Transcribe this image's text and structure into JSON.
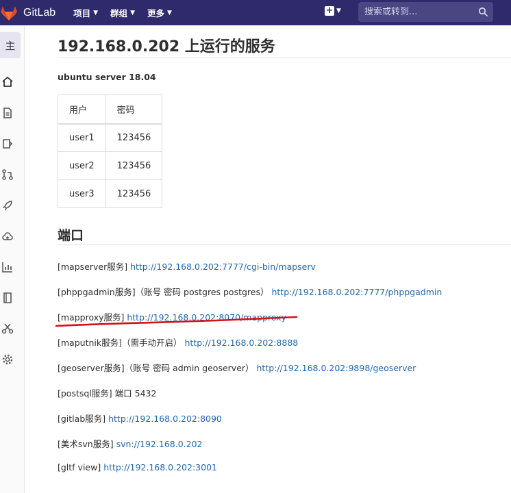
{
  "navbar": {
    "brand": "GitLab",
    "menu": [
      {
        "label": "项目"
      },
      {
        "label": "群组"
      },
      {
        "label": "更多"
      }
    ],
    "search_placeholder": "搜索或转到...",
    "colors": {
      "background": "#2f2a6b",
      "search_bg": "#4a4583"
    }
  },
  "sidebar": {
    "avatar_letter": "主",
    "icons": [
      "home-icon",
      "document-icon",
      "issues-icon",
      "merge-request-icon",
      "rocket-icon",
      "cloud-icon",
      "analytics-icon",
      "wiki-icon",
      "snippets-icon",
      "settings-icon"
    ]
  },
  "page": {
    "title": "192.168.0.202 上运行的服务",
    "subtitle": "ubuntu server 18.04",
    "table": {
      "headers": [
        "用户",
        "密码"
      ],
      "rows": [
        [
          "user1",
          "123456"
        ],
        [
          "user2",
          "123456"
        ],
        [
          "user3",
          "123456"
        ]
      ]
    },
    "ports_title": "端口",
    "services": [
      {
        "text": "[mapserver服务] ",
        "link": "http://192.168.0.202:7777/cgi-bin/mapserv"
      },
      {
        "text": "[phppgadmin服务]（账号 密码 postgres postgres） ",
        "link": "http://192.168.0.202:7777/phppgadmin"
      },
      {
        "text": "[mapproxy服务] ",
        "link": "http://192.168.0.202:8070/mapproxy"
      },
      {
        "text": "[maputnik服务]（需手动开启） ",
        "link": "http://192.168.0.202:8888"
      },
      {
        "text": "[geoserver服务]（账号 密码 admin geoserver） ",
        "link": "http://192.168.0.202:9898/geoserver"
      },
      {
        "text": "[postsql服务] 端口 5432",
        "link": ""
      },
      {
        "text": "[gitlab服务] ",
        "link": "http://192.168.0.202:8090"
      },
      {
        "text": "[美术svn服务] ",
        "link": "svn://192.168.0.202"
      },
      {
        "text": "[gltf view] ",
        "link": "http://192.168.0.202:3001"
      }
    ],
    "link_color": "#1f66b0",
    "annotation_color": "#d3121a"
  }
}
